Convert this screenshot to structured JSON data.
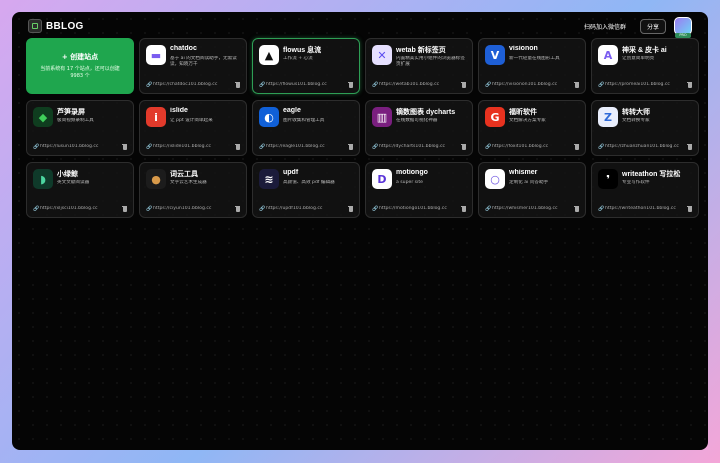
{
  "header": {
    "brand": "BBLOG",
    "wechat_label": "扫码加入微信群",
    "share_label": "分享",
    "avatar_badge": "PRO"
  },
  "create": {
    "title": "+ 创建站点",
    "desc": "当前系统有 17 个站点，还可以创建 9983 个"
  },
  "cards": [
    {
      "name": "chatdoc",
      "desc": "基于 ai 的文档阅读助手，无需读读，知晓万千",
      "url": "https://chatdoc101.bblog.cc",
      "icon": "chat-bubble-icon",
      "icon_bg": "#ffffff",
      "icon_fg": "#7a5cf0"
    },
    {
      "name": "flowus 息流",
      "desc": "工作流 + 心流",
      "url": "https://flowus101.bblog.cc",
      "icon": "flowus-icon",
      "icon_bg": "#ffffff",
      "icon_fg": "#111111",
      "highlight": true
    },
    {
      "name": "wetab 新标签页",
      "desc": "内置精美实用小组件的浏览器标签页扩展",
      "url": "https://wetab101.bblog.cc",
      "icon": "wetab-icon",
      "icon_bg": "#e6e0ff",
      "icon_fg": "#5c4ef0"
    },
    {
      "name": "visionon",
      "desc": "新一代轻量在线图形工具",
      "url": "https://visionon101.bblog.cc",
      "icon": "visionon-icon",
      "icon_bg": "#1e5fd6",
      "icon_fg": "#ffffff"
    },
    {
      "name": "神采 & 皮卡 ai",
      "desc": "让创意简单明亮",
      "url": "https://promeai101.bblog.cc",
      "icon": "promeai-icon",
      "icon_bg": "#ffffff",
      "icon_fg": "#7a5cf0"
    },
    {
      "name": "芦笋录屏",
      "desc": "极简视频录制工具",
      "url": "https://lusun101.bblog.cc",
      "icon": "lusun-icon",
      "icon_bg": "#0f3d1f",
      "icon_fg": "#3fcf5a"
    },
    {
      "name": "islide",
      "desc": "让 ppt 设计简单起来",
      "url": "https://islide101.bblog.cc",
      "icon": "islide-icon",
      "icon_bg": "#e23a2b",
      "icon_fg": "#ffffff"
    },
    {
      "name": "eagle",
      "desc": "图片收集和管理工具",
      "url": "https://eagle101.bblog.cc",
      "icon": "eagle-icon",
      "icon_bg": "#1060d8",
      "icon_fg": "#ffffff"
    },
    {
      "name": "镝数图表 dycharts",
      "desc": "在线数据可视化神器",
      "url": "https://dycharts101.bblog.cc",
      "icon": "dycharts-icon",
      "icon_bg": "#7a1f7f",
      "icon_fg": "#ffffff"
    },
    {
      "name": "福昕软件",
      "desc": "文档解决方案专家",
      "url": "https://foxit101.bblog.cc",
      "icon": "foxit-icon",
      "icon_bg": "#e8321f",
      "icon_fg": "#ffffff"
    },
    {
      "name": "转转大师",
      "desc": "文档转换专家",
      "url": "https://zhuanzhuan101.bblog.cc",
      "icon": "zhuanzhuan-icon",
      "icon_bg": "#e9eefc",
      "icon_fg": "#2f6ad8"
    },
    {
      "name": "小绿鲸",
      "desc": "英文文献阅读器",
      "url": "https://xljsci101.bblog.cc",
      "icon": "xiaolvjing-icon",
      "icon_bg": "#0f3a2a",
      "icon_fg": "#4cd6a0"
    },
    {
      "name": "词云工具",
      "desc": "文字云艺术生成器",
      "url": "https://ciyun101.bblog.cc",
      "icon": "ciyun-icon",
      "icon_bg": "#1c1c1c",
      "icon_fg": "#d89a4a"
    },
    {
      "name": "updf",
      "desc": "高颜值、高效 pdf 编辑器",
      "url": "https://updf101.bblog.cc",
      "icon": "updf-icon",
      "icon_bg": "#1b1b3a",
      "icon_fg": "#ffffff"
    },
    {
      "name": "motiongo",
      "desc": "a super site",
      "url": "https://motiongo101.bblog.cc",
      "icon": "motiongo-icon",
      "icon_bg": "#ffffff",
      "icon_fg": "#5a34d8"
    },
    {
      "name": "whismer",
      "desc": "定制化 ai 问答助手",
      "url": "https://whismer101.bblog.cc",
      "icon": "whismer-icon",
      "icon_bg": "#ffffff",
      "icon_fg": "#6a4fe0"
    },
    {
      "name": "writeathon 写拉松",
      "desc": "专业写作软件",
      "url": "https://writeathon101.bblog.cc",
      "icon": "writeathon-icon",
      "icon_bg": "#000000",
      "icon_fg": "#ffffff"
    }
  ]
}
